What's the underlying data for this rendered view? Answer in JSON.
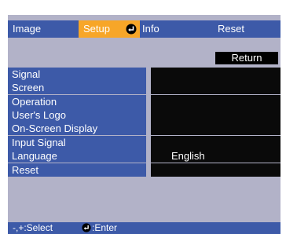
{
  "tabs": [
    {
      "label": "Image",
      "selected": false
    },
    {
      "label": "Setup",
      "selected": true
    },
    {
      "label": "Info",
      "selected": false
    },
    {
      "label": "Reset",
      "selected": false
    }
  ],
  "return_label": "Return",
  "menu": {
    "groups": [
      {
        "items": [
          {
            "label": "Signal",
            "value": ""
          },
          {
            "label": "Screen",
            "value": ""
          }
        ]
      },
      {
        "items": [
          {
            "label": "Operation",
            "value": ""
          },
          {
            "label": "User's Logo",
            "value": ""
          },
          {
            "label": "On-Screen Display",
            "value": ""
          }
        ]
      },
      {
        "items": [
          {
            "label": "Input Signal",
            "value": ""
          },
          {
            "label": "Language",
            "value": "English"
          }
        ]
      },
      {
        "items": [
          {
            "label": "Reset",
            "value": ""
          }
        ]
      }
    ]
  },
  "status": {
    "select_text": "-,+:Select",
    "enter_text": ":Enter"
  },
  "colors": {
    "bar_blue": "#3d5aa8",
    "tab_selected": "#f7a628",
    "background": "#b2b2c8",
    "value_black": "#0a0a0a"
  },
  "icons": {
    "enter": "enter-icon"
  }
}
